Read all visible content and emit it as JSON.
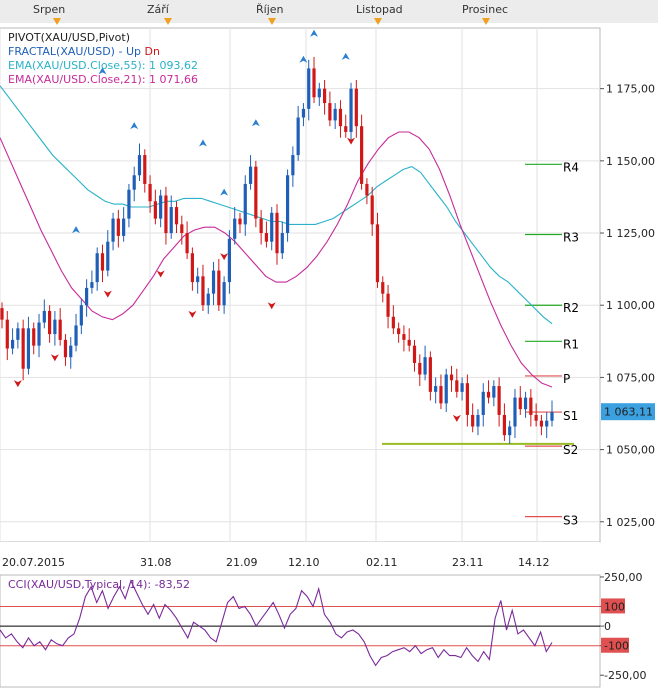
{
  "header": {
    "months": [
      "Srpen",
      "Září",
      "Říjen",
      "Listopad",
      "Prosinec"
    ]
  },
  "legend": {
    "pivot": "PIVOT(XAU/USD,Pivot)",
    "fractal": "FRACTAL(XAU/USD)",
    "fractal_sep": "-",
    "fractal_up": "Up",
    "fractal_dn": "Dn",
    "ema55": "EMA(XAU/USD.Close,55): 1 093,62",
    "ema21": "EMA(XAU/USD.Close,21): 1 071,66",
    "cci": "CCI(XAU/USD,Typical, 14): -83,52"
  },
  "colors": {
    "up_candle": "#1f5fb8",
    "down_candle": "#d01818",
    "ema55": "#29b2c8",
    "ema21": "#c62b9a",
    "pivot_lines": "#22aa22",
    "support_line": "#99bb22",
    "fractal_up": "#2a7fd0",
    "fractal_dn": "#d01818",
    "cci": "#7a2a9a",
    "price_tag": "#3aa0e0",
    "cci_bands": "#e05050"
  },
  "chart_data": [
    {
      "type": "candlestick",
      "instrument": "XAU/USD",
      "ylim": [
        1018,
        1196
      ],
      "y_ticks": [
        {
          "value": 1025,
          "label": "1 025,00"
        },
        {
          "value": 1050,
          "label": "1 050,00"
        },
        {
          "value": 1075,
          "label": "1 075,00"
        },
        {
          "value": 1100,
          "label": "1 100,00"
        },
        {
          "value": 1125,
          "label": "1 125,00"
        },
        {
          "value": 1150,
          "label": "1 150,00"
        },
        {
          "value": 1175,
          "label": "1 175,00"
        }
      ],
      "x_ticks": [
        "20.07.2015",
        "31.08",
        "21.09",
        "12.10",
        "02.11",
        "23.11",
        "14.12"
      ],
      "last_price": {
        "value": 1063.11,
        "label": "1 063,11"
      },
      "pivot_levels": [
        {
          "name": "R4",
          "value": 1148.8
        },
        {
          "name": "R3",
          "value": 1124.5
        },
        {
          "name": "R2",
          "value": 1100.0
        },
        {
          "name": "R1",
          "value": 1087.5
        },
        {
          "name": "P",
          "value": 1075.5
        },
        {
          "name": "S1",
          "value": 1063.0
        },
        {
          "name": "S2",
          "value": 1051.2
        },
        {
          "name": "S3",
          "value": 1026.8
        }
      ],
      "support_line": 1052.0,
      "close": [
        1095,
        1085,
        1088,
        1092,
        1078,
        1092,
        1086,
        1094,
        1098,
        1090,
        1095,
        1088,
        1082,
        1086,
        1093,
        1100,
        1106,
        1108,
        1118,
        1112,
        1122,
        1130,
        1124,
        1130,
        1140,
        1145,
        1152,
        1142,
        1136,
        1130,
        1138,
        1125,
        1134,
        1128,
        1125,
        1118,
        1108,
        1110,
        1100,
        1104,
        1112,
        1100,
        1108,
        1123,
        1130,
        1128,
        1142,
        1148,
        1130,
        1125,
        1122,
        1132,
        1118,
        1125,
        1145,
        1152,
        1165,
        1168,
        1182,
        1172,
        1175,
        1170,
        1164,
        1168,
        1162,
        1160,
        1175,
        1162,
        1142,
        1138,
        1128,
        1108,
        1104,
        1096,
        1092,
        1090,
        1088,
        1086,
        1080,
        1076,
        1082,
        1070,
        1072,
        1066,
        1076,
        1074,
        1070,
        1073,
        1062,
        1058,
        1062,
        1070,
        1068,
        1072,
        1062,
        1055,
        1058,
        1068,
        1064,
        1068,
        1062,
        1060,
        1058,
        1060,
        1063
      ],
      "ema55": [
        1176,
        1172,
        1168,
        1164,
        1160,
        1156,
        1152,
        1149,
        1146,
        1143,
        1140,
        1138,
        1136,
        1135,
        1135,
        1134,
        1134,
        1134,
        1135,
        1136,
        1136,
        1137,
        1137,
        1137,
        1136,
        1135,
        1134,
        1133,
        1132,
        1131,
        1130,
        1129,
        1129,
        1128,
        1128,
        1128,
        1128,
        1129,
        1130,
        1132,
        1134,
        1136,
        1138,
        1141,
        1143,
        1145,
        1147,
        1148,
        1146,
        1142,
        1138,
        1134,
        1129,
        1125,
        1121,
        1117,
        1113,
        1110,
        1108,
        1105,
        1102,
        1099,
        1096,
        1093.6
      ],
      "ema21": [
        1158,
        1150,
        1142,
        1134,
        1126,
        1119,
        1112,
        1106,
        1102,
        1098,
        1096,
        1095,
        1097,
        1100,
        1105,
        1110,
        1116,
        1120,
        1124,
        1126,
        1127,
        1127,
        1125,
        1122,
        1118,
        1114,
        1110,
        1108,
        1108,
        1110,
        1113,
        1117,
        1122,
        1128,
        1135,
        1143,
        1149,
        1154,
        1158,
        1160,
        1160,
        1158,
        1154,
        1147,
        1138,
        1128,
        1119,
        1110,
        1101,
        1093,
        1086,
        1080,
        1076,
        1073,
        1071.66
      ],
      "fractals_up": [
        {
          "x_index": 14,
          "value": 1126
        },
        {
          "x_index": 19,
          "value": 1181
        },
        {
          "x_index": 25,
          "value": 1162
        },
        {
          "x_index": 38,
          "value": 1156
        },
        {
          "x_index": 42,
          "value": 1139
        },
        {
          "x_index": 48,
          "value": 1163
        },
        {
          "x_index": 57,
          "value": 1185
        },
        {
          "x_index": 59,
          "value": 1194
        },
        {
          "x_index": 65,
          "value": 1186
        }
      ],
      "fractals_dn": [
        {
          "x_index": 3,
          "value": 1073
        },
        {
          "x_index": 10,
          "value": 1082
        },
        {
          "x_index": 20,
          "value": 1104
        },
        {
          "x_index": 30,
          "value": 1111
        },
        {
          "x_index": 36,
          "value": 1097
        },
        {
          "x_index": 42,
          "value": 1117
        },
        {
          "x_index": 51,
          "value": 1100
        },
        {
          "x_index": 66,
          "value": 1157
        },
        {
          "x_index": 86,
          "value": 1061
        }
      ]
    },
    {
      "type": "line",
      "name": "CCI",
      "ylim": [
        -310,
        260
      ],
      "y_ticks": [
        {
          "value": 250,
          "label": "250,00"
        },
        {
          "value": 100,
          "label": "100"
        },
        {
          "value": 0,
          "label": "0"
        },
        {
          "value": -100,
          "label": "-100"
        },
        {
          "value": -250,
          "label": "-250,00"
        }
      ],
      "levels": [
        100,
        0,
        -100
      ],
      "current": -83.52,
      "values": [
        -20,
        -60,
        -40,
        -80,
        -110,
        -60,
        -100,
        -80,
        -120,
        -70,
        -90,
        -100,
        -60,
        -40,
        40,
        150,
        200,
        120,
        180,
        90,
        150,
        200,
        140,
        230,
        170,
        110,
        60,
        110,
        40,
        110,
        80,
        40,
        -10,
        -60,
        20,
        0,
        -20,
        -60,
        -80,
        20,
        120,
        150,
        90,
        100,
        60,
        0,
        40,
        80,
        120,
        60,
        -10,
        60,
        90,
        180,
        150,
        100,
        190,
        60,
        20,
        -40,
        -60,
        -30,
        -20,
        -40,
        -80,
        -150,
        -200,
        -160,
        -150,
        -130,
        -120,
        -110,
        -130,
        -100,
        -140,
        -120,
        -110,
        -160,
        -120,
        -150,
        -150,
        -160,
        -110,
        -150,
        -180,
        -130,
        -170,
        40,
        130,
        -20,
        80,
        -40,
        -20,
        -60,
        -100,
        -30,
        -130,
        -83.52
      ]
    }
  ]
}
